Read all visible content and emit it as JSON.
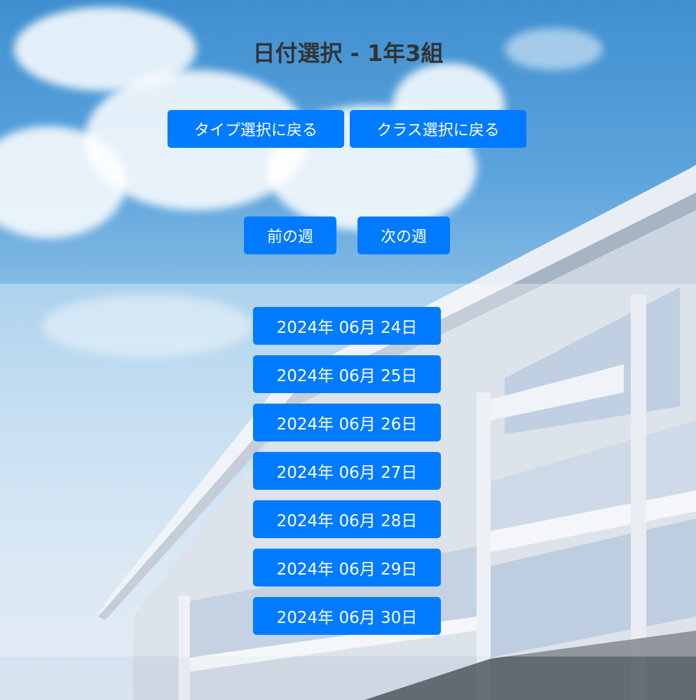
{
  "header": {
    "title": "日付選択 - 1年3組"
  },
  "nav": {
    "back_to_type": "タイプ選択に戻る",
    "back_to_class": "クラス選択に戻る"
  },
  "week_nav": {
    "prev": "前の週",
    "next": "次の週"
  },
  "dates": [
    "2024年 06月 24日",
    "2024年 06月 25日",
    "2024年 06月 26日",
    "2024年 06月 27日",
    "2024年 06月 28日",
    "2024年 06月 29日",
    "2024年 06月 30日"
  ],
  "colors": {
    "button": "#007bff",
    "title": "#333333"
  }
}
